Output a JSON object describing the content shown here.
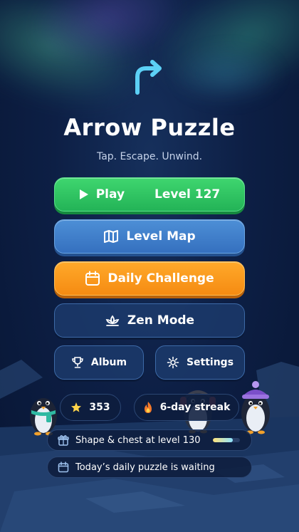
{
  "app": {
    "title": "Arrow Puzzle",
    "tagline": "Tap. Escape. Unwind."
  },
  "menu": {
    "play_label": "Play",
    "play_level": "Level 127",
    "level_map_label": "Level Map",
    "daily_challenge_label": "Daily Challenge",
    "zen_mode_label": "Zen Mode",
    "album_label": "Album",
    "settings_label": "Settings"
  },
  "stats": {
    "stars": "353",
    "streak": "6-day streak"
  },
  "banners": {
    "reward_text": "Shape & chest at level 130",
    "reward_progress": 0.75,
    "daily_text": "Today’s daily puzzle is waiting"
  },
  "colors": {
    "play": "#2fc562",
    "map": "#4281cb",
    "daily": "#fb9a1e",
    "secondary": "#1e3e70",
    "logo_arrow": "#5cd0f5"
  },
  "icons": {
    "logo": "curved-arrow-icon",
    "play": "play-triangle-icon",
    "map": "map-icon",
    "daily": "calendar-icon",
    "zen": "lotus-icon",
    "album": "trophy-icon",
    "settings": "gear-icon",
    "stars": "star-icon",
    "streak": "flame-icon",
    "reward": "gift-icon",
    "daily_banner": "calendar-icon"
  }
}
